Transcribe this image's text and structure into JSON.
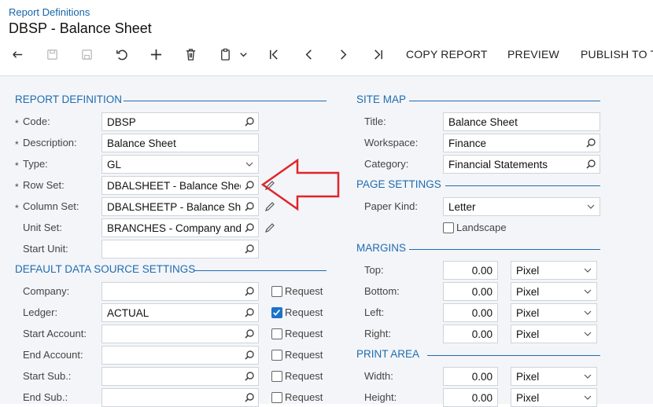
{
  "header": {
    "breadcrumb": "Report Definitions",
    "title": "DBSP - Balance Sheet"
  },
  "toolbar": {
    "copy": "COPY REPORT",
    "preview": "PREVIEW",
    "publish": "PUBLISH TO T"
  },
  "report_definition": {
    "section": "REPORT DEFINITION",
    "code_label": "Code:",
    "code": "DBSP",
    "description_label": "Description:",
    "description": "Balance Sheet",
    "type_label": "Type:",
    "type": "GL",
    "row_set_label": "Row Set:",
    "row_set": "DBALSHEET - Balance Shee",
    "column_set_label": "Column Set:",
    "column_set": "DBALSHEETP - Balance She",
    "unit_set_label": "Unit Set:",
    "unit_set": "BRANCHES - Company and I",
    "start_unit_label": "Start Unit:",
    "start_unit": ""
  },
  "data_source": {
    "section": "DEFAULT DATA SOURCE SETTINGS",
    "request_label": "Request",
    "company_label": "Company:",
    "company": "",
    "ledger_label": "Ledger:",
    "ledger": "ACTUAL",
    "start_account_label": "Start Account:",
    "start_account": "",
    "end_account_label": "End Account:",
    "end_account": "",
    "start_sub_label": "Start Sub.:",
    "start_sub": "",
    "end_sub_label": "End Sub.:",
    "end_sub": ""
  },
  "site_map": {
    "section": "SITE MAP",
    "title_label": "Title:",
    "title": "Balance Sheet",
    "workspace_label": "Workspace:",
    "workspace": "Finance",
    "category_label": "Category:",
    "category": "Financial Statements"
  },
  "page_settings": {
    "section": "PAGE SETTINGS",
    "paper_kind_label": "Paper Kind:",
    "paper_kind": "Letter",
    "landscape_label": "Landscape"
  },
  "margins": {
    "section": "MARGINS",
    "top_label": "Top:",
    "top": "0.00",
    "bottom_label": "Bottom:",
    "bottom": "0.00",
    "left_label": "Left:",
    "left": "0.00",
    "right_label": "Right:",
    "right": "0.00",
    "unit": "Pixel"
  },
  "print_area": {
    "section": "PRINT AREA",
    "width_label": "Width:",
    "width": "0.00",
    "height_label": "Height:",
    "height": "0.00",
    "unit": "Pixel"
  },
  "colors": {
    "accent": "#1f6cb0",
    "arrow": "#e0252b",
    "checkbox": "#1a73c8"
  }
}
